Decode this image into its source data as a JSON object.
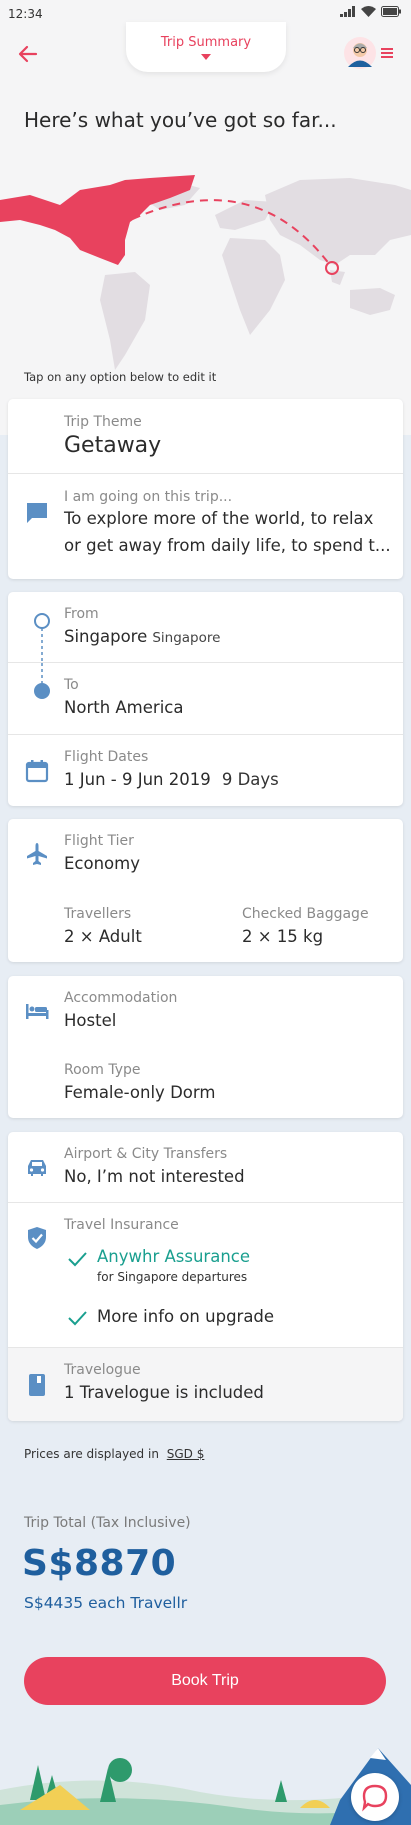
{
  "status_bar": {
    "time": "12:34"
  },
  "header": {
    "tab_title": "Trip Summary"
  },
  "headline": "Here’s what you’ve got so far...",
  "tap_hint": "Tap on any option below to edit it",
  "theme": {
    "label": "Trip Theme",
    "value": "Getaway",
    "note_label": "I am going on this trip...",
    "note_line1": "To explore more of the world, to relax",
    "note_line2": "or get away from daily life, to spend t..."
  },
  "route": {
    "from_label": "From",
    "from_value": "Singapore",
    "from_sub": "Singapore",
    "to_label": "To",
    "to_value": "North America",
    "dates_label": "Flight Dates",
    "dates_value": "1 Jun - 9 Jun 2019",
    "dates_days": "9 Days"
  },
  "flight": {
    "tier_label": "Flight Tier",
    "tier_value": "Economy",
    "travellers_label": "Travellers",
    "travellers_value": "2 × Adult",
    "baggage_label": "Checked Baggage",
    "baggage_value": "2 × 15 kg"
  },
  "accommodation": {
    "label": "Accommodation",
    "value": "Hostel",
    "room_label": "Room Type",
    "room_value": "Female-only Dorm"
  },
  "extras": {
    "transfers_label": "Airport & City Transfers",
    "transfers_value": "No, I’m not interested",
    "insurance_label": "Travel Insurance",
    "insurance_value": "Anywhr Assurance",
    "insurance_sub": "for Singapore departures",
    "upgrade_label": "More info on upgrade",
    "travelogue_label": "Travelogue",
    "travelogue_value": "1 Travelogue is included"
  },
  "pricing": {
    "note_prefix": "Prices are displayed in",
    "currency": "SGD $",
    "total_label": "Trip Total (Tax Inclusive)",
    "total_value": "S$8870",
    "each_value": "S$4435 each Travellr"
  },
  "book_button": "Book Trip",
  "colors": {
    "accent": "#e8425e",
    "primary": "#1f5f9e",
    "icon": "#5b8fc4",
    "teal": "#1a9f8f"
  }
}
